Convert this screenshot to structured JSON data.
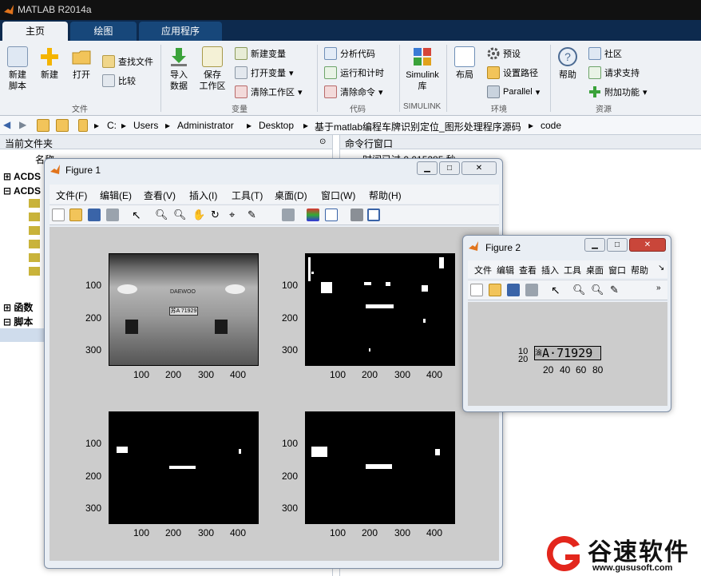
{
  "app": {
    "title": "MATLAB R2014a"
  },
  "tabs": [
    {
      "label": "主页"
    },
    {
      "label": "绘图"
    },
    {
      "label": "应用程序"
    }
  ],
  "ribbon": {
    "file": {
      "new_script": "新建\n脚本",
      "new": "新建",
      "open": "打开",
      "find_files": "查找文件",
      "compare": "比较",
      "group": "文件"
    },
    "variable": {
      "import": "导入\n数据",
      "save_ws": "保存\n工作区",
      "new_var": "新建变量",
      "open_var": "打开变量",
      "clear_ws": "清除工作区",
      "group": "变量"
    },
    "code": {
      "analyze": "分析代码",
      "run_time": "运行和计时",
      "clear_cmd": "清除命令",
      "group": "代码"
    },
    "simulink": {
      "label": "Simulink\n库",
      "group": "SIMULINK"
    },
    "env": {
      "layout": "布局",
      "prefs": "预设",
      "set_path": "设置路径",
      "parallel": "Parallel",
      "group": "环境"
    },
    "resources": {
      "help": "帮助",
      "community": "社区",
      "support": "请求支持",
      "addons": "附加功能",
      "group": "资源"
    }
  },
  "address": {
    "crumbs": [
      "C:",
      "Users",
      "Administrator",
      "Desktop",
      "基于matlab编程车牌识别定位_图形处理程序源码",
      "code"
    ]
  },
  "left_panel": {
    "title": "当前文件夹",
    "col_name": "名称",
    "tree": [
      "ACDS",
      "ACDS",
      "函数",
      "脚本"
    ]
  },
  "right_panel": {
    "title": "命令行窗口",
    "partial": "时间已过 0.015285 秒"
  },
  "figure1": {
    "title": "Figure 1",
    "menu": [
      "文件(F)",
      "编辑(E)",
      "查看(V)",
      "插入(I)",
      "工具(T)",
      "桌面(D)",
      "窗口(W)",
      "帮助(H)"
    ],
    "yticks": [
      "100",
      "200",
      "300"
    ],
    "xticks": [
      "100",
      "200",
      "300",
      "400"
    ],
    "plate_text": "苏A 71929",
    "car_badge": "DAEWOO"
  },
  "figure2": {
    "title": "Figure 2",
    "menu": [
      "文件",
      "编辑",
      "查看",
      "插入",
      "工具",
      "桌面",
      "窗口",
      "帮助"
    ],
    "yticks": [
      "10",
      "20"
    ],
    "xticks": [
      "20",
      "40",
      "60",
      "80"
    ],
    "plate_text": "A·71929",
    "plate_prefix": "渝"
  },
  "watermark": {
    "brand": "谷速软件",
    "url": "www.gususoft.com"
  },
  "colors": {
    "matlab_orange": "#e1741c",
    "tab_blue": "#17477a",
    "watermark_red": "#e3261c"
  }
}
